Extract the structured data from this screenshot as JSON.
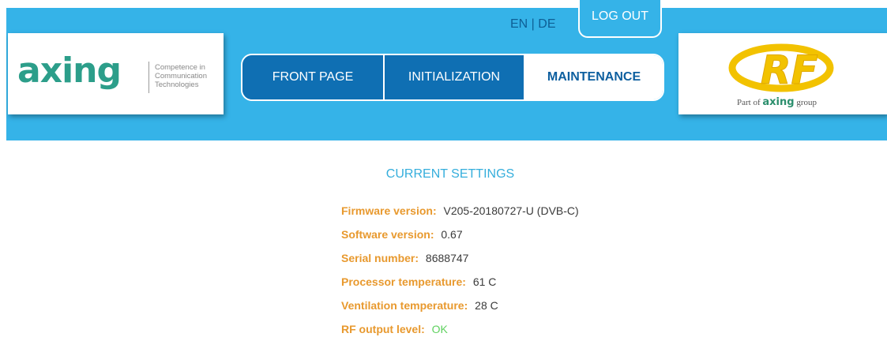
{
  "header": {
    "brand_left": {
      "wordmark": "axing",
      "tagline": [
        "Competence in",
        "Communication",
        "Technologies"
      ]
    },
    "brand_right": {
      "logo": "RF",
      "caption_prefix": "Part of",
      "caption_brand": "axing",
      "caption_suffix": "group"
    },
    "language": "EN | DE",
    "logout_label": "LOG OUT"
  },
  "nav": {
    "tabs": [
      {
        "label": "FRONT PAGE",
        "active": false
      },
      {
        "label": "INITIALIZATION",
        "active": false
      },
      {
        "label": "MAINTENANCE",
        "active": true
      }
    ]
  },
  "settings": {
    "title": "CURRENT SETTINGS",
    "rows": [
      {
        "label": "Firmware version:",
        "value": "V205-20180727-U (DVB-C)"
      },
      {
        "label": "Software version:",
        "value": "0.67"
      },
      {
        "label": "Serial number:",
        "value": "8688747"
      },
      {
        "label": "Processor temperature:",
        "value": "61 C"
      },
      {
        "label": "Ventilation temperature:",
        "value": "28 C"
      },
      {
        "label": "RF output level:",
        "value": "OK"
      }
    ]
  },
  "colors": {
    "header_bg": "#35b3e8",
    "nav_tab_bg": "#0f6fb3",
    "label_orange": "#e8992e",
    "ok_green": "#5fd15f",
    "title_blue": "#35aedc"
  }
}
